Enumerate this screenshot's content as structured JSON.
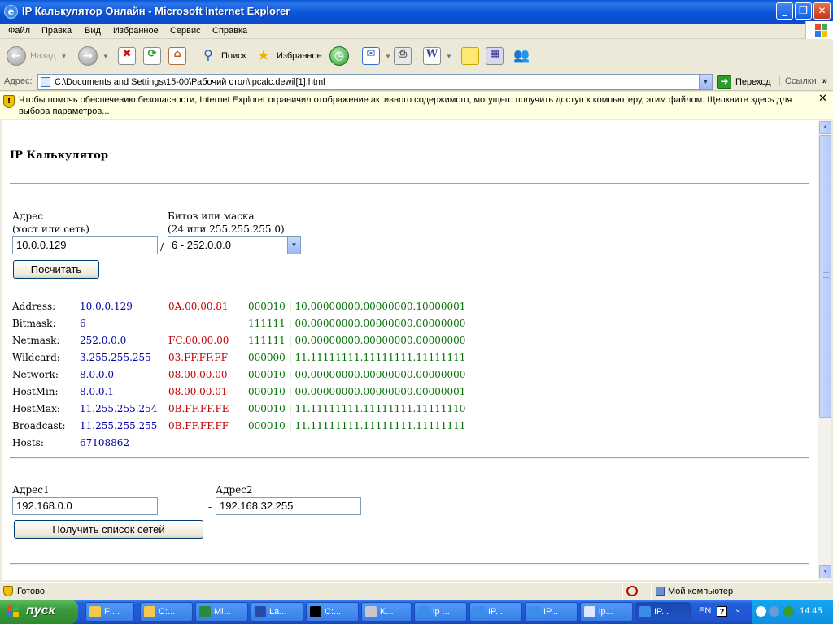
{
  "window": {
    "title": "IP Калькулятор Онлайн - Microsoft Internet Explorer",
    "min_icon": "minimize-icon",
    "max_icon": "restore-icon",
    "close_icon": "close-icon"
  },
  "menu": {
    "items": [
      "Файл",
      "Правка",
      "Вид",
      "Избранное",
      "Сервис",
      "Справка"
    ]
  },
  "toolbar": {
    "back": "Назад",
    "search": "Поиск",
    "favorites": "Избранное"
  },
  "address": {
    "label": "Адрес:",
    "url": "C:\\Documents and Settings\\15-00\\Рабочий стол\\ipcalc.dewil[1].html",
    "go": "Переход",
    "links": "Ссылки"
  },
  "infobar": {
    "text": "Чтобы помочь обеспечению безопасности, Internet Explorer ограничил отображение активного содержимого, могущего получить доступ к компьютеру, этим файлом. Щелкните здесь для выбора параметров..."
  },
  "page": {
    "heading": "IP Калькулятор",
    "address_label_1": "Адрес",
    "address_label_2": "(хост или сеть)",
    "address_value": "10.0.0.129",
    "slash": "/",
    "mask_label_1": "Битов или маска",
    "mask_label_2": "(24 или 255.255.255.0)",
    "mask_value": "6 - 252.0.0.0",
    "calc_button": "Посчитать",
    "results": [
      {
        "label": "Address:",
        "dec": "10.0.0.129",
        "hex": "0A.00.00.81",
        "bin": "000010 | 10.00000000.00000000.10000001"
      },
      {
        "label": "Bitmask:",
        "dec": "6",
        "hex": "",
        "bin": "111111 | 00.00000000.00000000.00000000"
      },
      {
        "label": "Netmask:",
        "dec": "252.0.0.0",
        "hex": "FC.00.00.00",
        "bin": "111111 | 00.00000000.00000000.00000000"
      },
      {
        "label": "Wildcard:",
        "dec": "3.255.255.255",
        "hex": "03.FF.FF.FF",
        "bin": "000000 | 11.11111111.11111111.11111111"
      },
      {
        "label": "Network:",
        "dec": "8.0.0.0",
        "hex": "08.00.00.00",
        "bin": "000010 | 00.00000000.00000000.00000000"
      },
      {
        "label": "HostMin:",
        "dec": "8.0.0.1",
        "hex": "08.00.00.01",
        "bin": "000010 | 00.00000000.00000000.00000001"
      },
      {
        "label": "HostMax:",
        "dec": "11.255.255.254",
        "hex": "0B.FF.FF.FE",
        "bin": "000010 | 11.11111111.11111111.11111110"
      },
      {
        "label": "Broadcast:",
        "dec": "11.255.255.255",
        "hex": "0B.FF.FF.FF",
        "bin": "000010 | 11.11111111.11111111.11111111"
      },
      {
        "label": "Hosts:",
        "dec": "67108862",
        "hex": "",
        "bin": ""
      }
    ],
    "addr1_label": "Адрес1",
    "addr1_value": "192.168.0.0",
    "dash": "-",
    "addr2_label": "Адрес2",
    "addr2_value": "192.168.32.255",
    "list_button": "Получить список сетей"
  },
  "status": {
    "text": "Готово",
    "zone": "Мой компьютер"
  },
  "taskbar": {
    "start": "пуск",
    "tasks": [
      "F:...",
      "C:...",
      "Mi...",
      "La...",
      "C:...",
      "K...",
      "ip ...",
      "IP...",
      "IP...",
      "ip...",
      "IP..."
    ],
    "lang": "EN",
    "time": "14:45"
  },
  "colors": {
    "dec": "#0000a8",
    "hex": "#c00000",
    "bin": "#007000"
  }
}
